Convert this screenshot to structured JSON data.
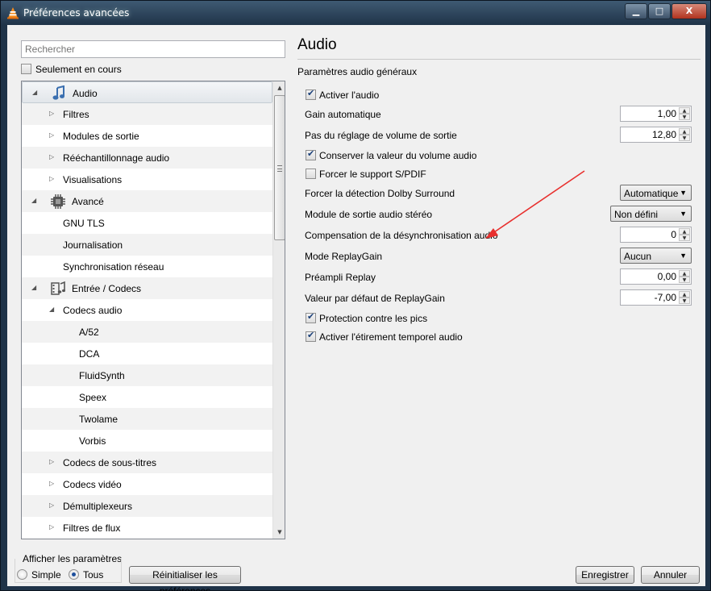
{
  "window": {
    "title": "Préférences avancées",
    "controls": {
      "minimize": "▁",
      "maximize": "□",
      "close": "X"
    }
  },
  "left": {
    "search_placeholder": "Rechercher",
    "only_current_label": "Seulement en cours",
    "only_current_checked": false,
    "tree": [
      {
        "label": "Audio",
        "level": 0,
        "expander": "open",
        "icon": "music-note-icon",
        "selected": true
      },
      {
        "label": "Filtres",
        "level": 1,
        "expander": "closed"
      },
      {
        "label": "Modules de sortie",
        "level": 1,
        "expander": "closed"
      },
      {
        "label": "Rééchantillonnage audio",
        "level": 1,
        "expander": "closed"
      },
      {
        "label": "Visualisations",
        "level": 1,
        "expander": "closed"
      },
      {
        "label": "Avancé",
        "level": 0,
        "expander": "open",
        "icon": "chip-icon"
      },
      {
        "label": "GNU TLS",
        "level": 1,
        "expander": "none"
      },
      {
        "label": "Journalisation",
        "level": 1,
        "expander": "none"
      },
      {
        "label": "Synchronisation réseau",
        "level": 1,
        "expander": "none"
      },
      {
        "label": "Entrée / Codecs",
        "level": 0,
        "expander": "open",
        "icon": "codec-icon"
      },
      {
        "label": "Codecs audio",
        "level": 1,
        "expander": "open"
      },
      {
        "label": "A/52",
        "level": 2,
        "expander": "none"
      },
      {
        "label": "DCA",
        "level": 2,
        "expander": "none"
      },
      {
        "label": "FluidSynth",
        "level": 2,
        "expander": "none"
      },
      {
        "label": "Speex",
        "level": 2,
        "expander": "none"
      },
      {
        "label": "Twolame",
        "level": 2,
        "expander": "none"
      },
      {
        "label": "Vorbis",
        "level": 2,
        "expander": "none"
      },
      {
        "label": "Codecs de sous-titres",
        "level": 1,
        "expander": "closed"
      },
      {
        "label": "Codecs vidéo",
        "level": 1,
        "expander": "closed"
      },
      {
        "label": "Démultiplexeurs",
        "level": 1,
        "expander": "closed"
      },
      {
        "label": "Filtres de flux",
        "level": 1,
        "expander": "closed"
      }
    ],
    "show_settings": {
      "label": "Afficher les paramètres",
      "options": [
        "Simple",
        "Tous"
      ],
      "selected": "Tous"
    },
    "reset_label": "Réinitialiser les préférences"
  },
  "right": {
    "title": "Audio",
    "section": "Paramètres audio généraux",
    "settings": [
      {
        "type": "check",
        "label": "Activer l'audio",
        "checked": true
      },
      {
        "type": "spin",
        "label": "Gain automatique",
        "value": "1,00"
      },
      {
        "type": "spin",
        "label": "Pas du réglage de volume de sortie",
        "value": "12,80"
      },
      {
        "type": "check",
        "label": "Conserver la valeur du volume audio",
        "checked": true
      },
      {
        "type": "check",
        "label": "Forcer le support S/PDIF",
        "checked": false
      },
      {
        "type": "combo",
        "label": "Forcer la détection Dolby Surround",
        "value": "Automatique"
      },
      {
        "type": "combo",
        "label": "Module de sortie audio stéréo",
        "value": "Non défini"
      },
      {
        "type": "spin",
        "label": "Compensation de la désynchronisation audio",
        "value": "0"
      },
      {
        "type": "combo",
        "label": "Mode ReplayGain",
        "value": "Aucun"
      },
      {
        "type": "spin",
        "label": "Préampli Replay",
        "value": "0,00"
      },
      {
        "type": "spin",
        "label": "Valeur par défaut de ReplayGain",
        "value": "-7,00"
      },
      {
        "type": "check",
        "label": "Protection contre les pics",
        "checked": true
      },
      {
        "type": "check",
        "label": "Activer l'étirement temporel audio",
        "checked": true
      }
    ]
  },
  "footer": {
    "save_label": "Enregistrer",
    "cancel_label": "Annuler"
  },
  "colors": {
    "annotation_arrow": "#e8302e",
    "selection": "#e2e6ea"
  }
}
